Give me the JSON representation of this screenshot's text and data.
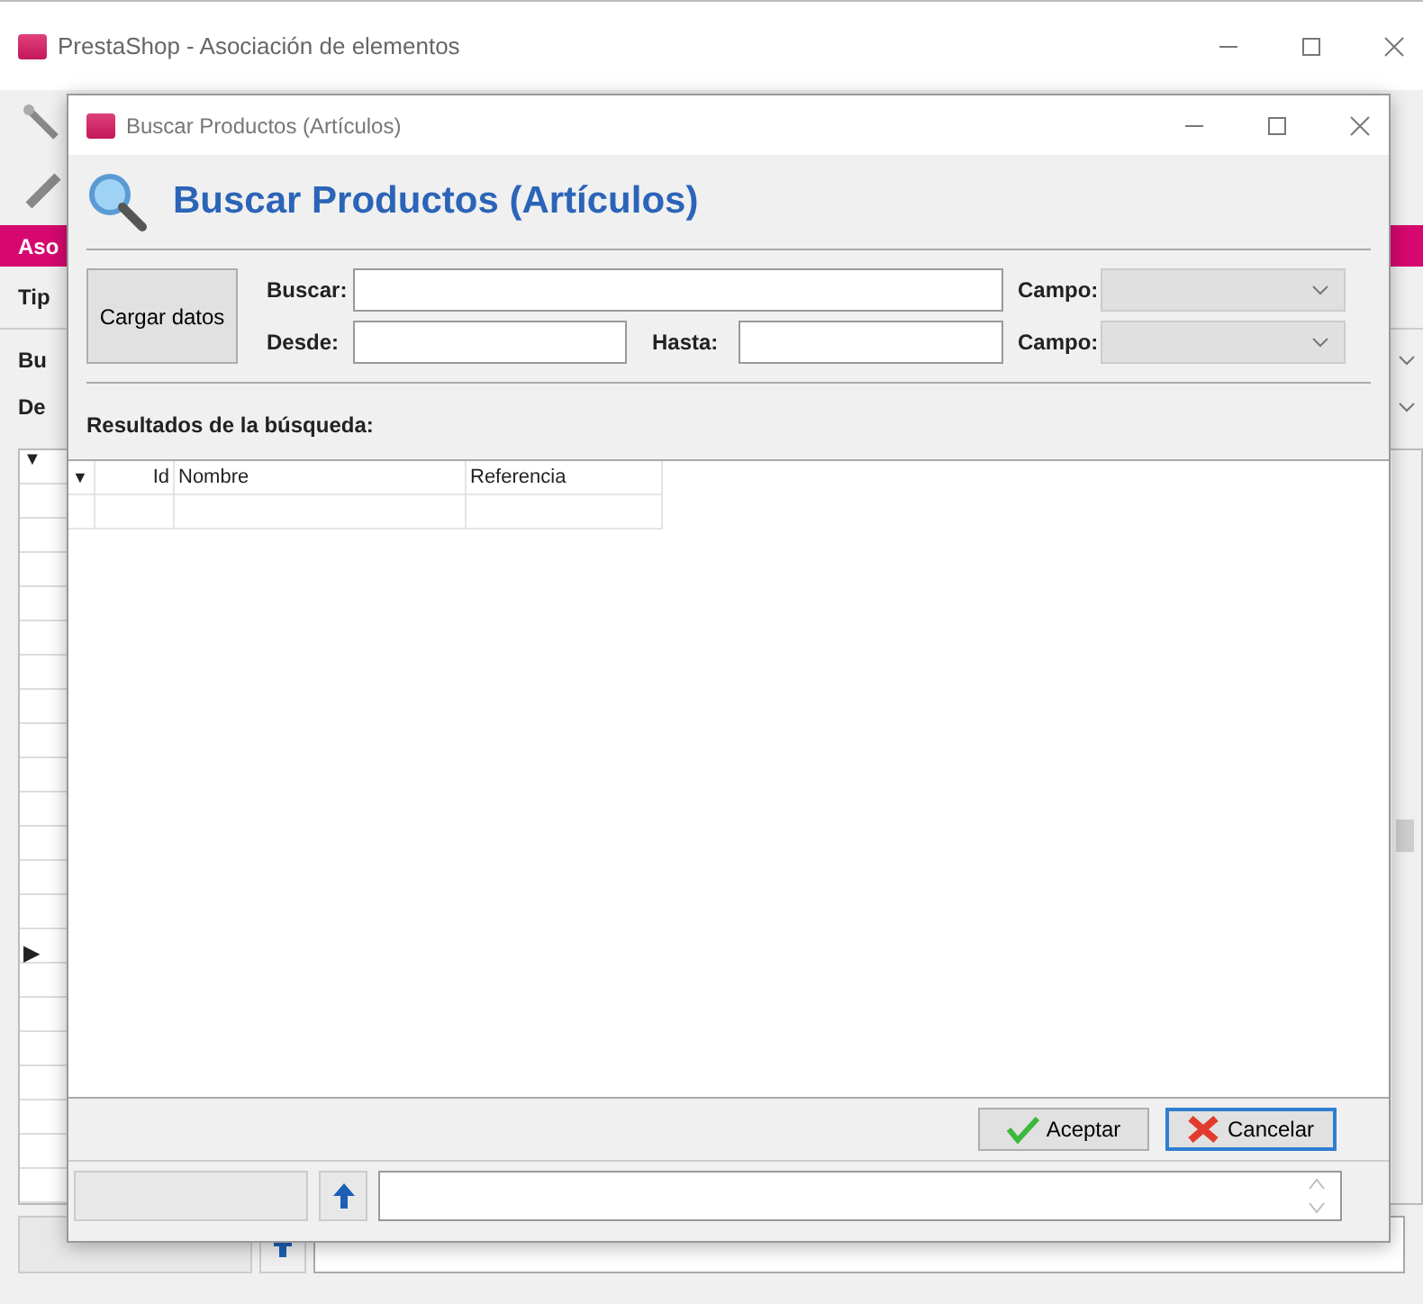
{
  "main_window": {
    "title": "PrestaShop - Asociación de elementos",
    "tab_label": "Aso",
    "labels": [
      "Tip",
      "Bu",
      "De"
    ],
    "grid_markers": [
      "▼",
      "▶"
    ]
  },
  "dialog": {
    "title": "Buscar Productos (Artículos)",
    "heading": "Buscar Productos (Artículos)",
    "load_button": "Cargar datos",
    "search_label": "Buscar:",
    "from_label": "Desde:",
    "to_label": "Hasta:",
    "field_labels": [
      "Campo:",
      "Campo:"
    ],
    "results_label": "Resultados de la búsqueda:",
    "table": {
      "filter_marker": "▼",
      "columns": [
        "Id",
        "Nombre",
        "Referencia"
      ]
    },
    "buttons": [
      {
        "label": "Aceptar",
        "kind": "accept",
        "focused": false
      },
      {
        "label": "Cancelar",
        "kind": "cancel",
        "focused": true
      }
    ]
  }
}
